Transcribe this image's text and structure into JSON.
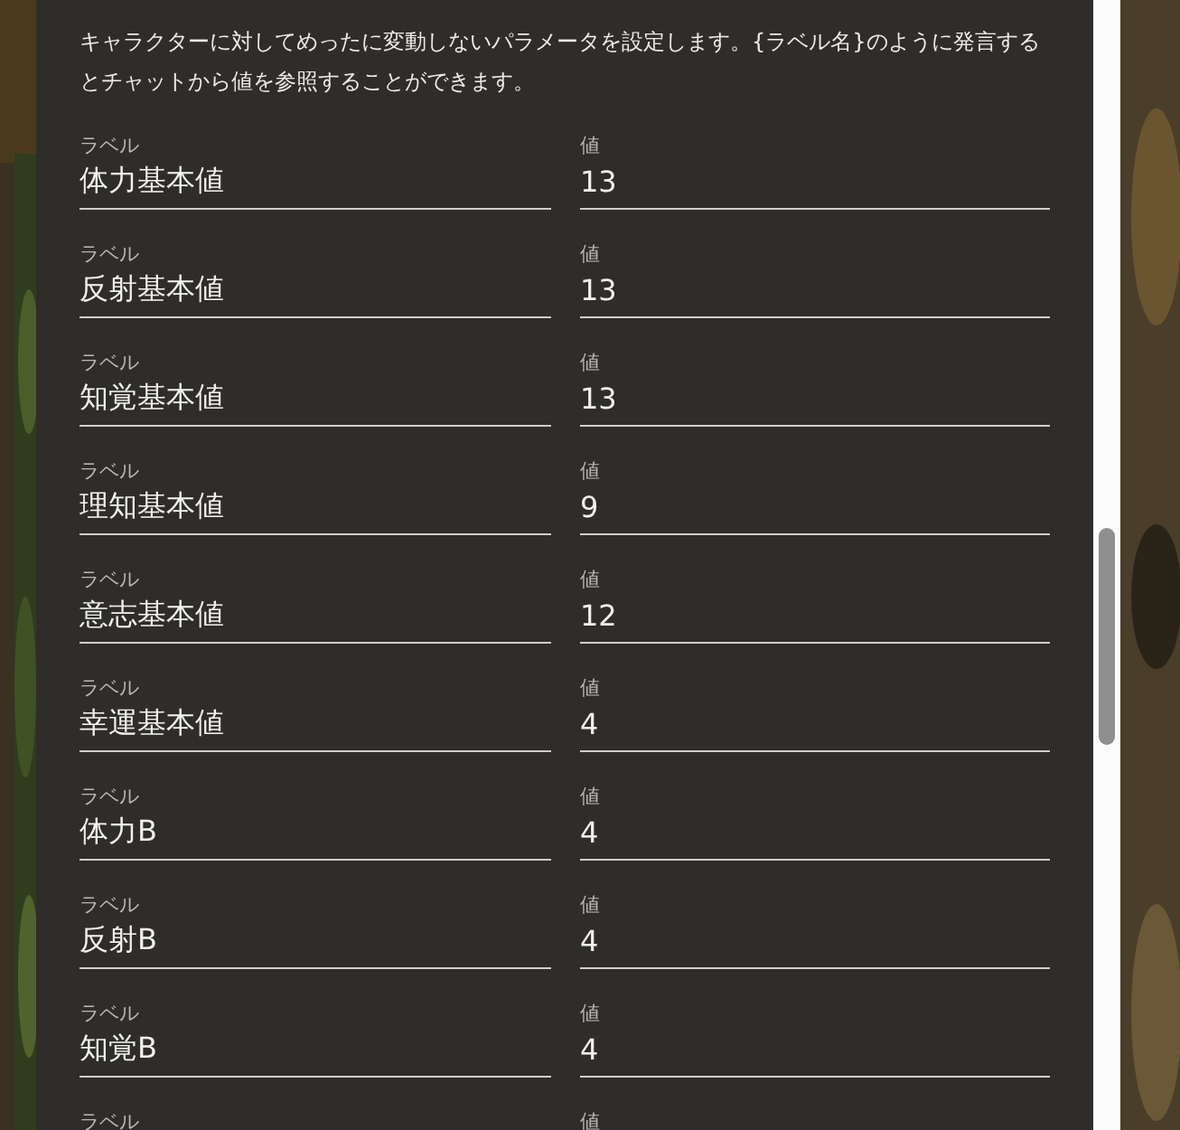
{
  "description": "キャラクターに対してめったに変動しないパラメータを設定します。{ラベル名}のように発言するとチャットから値を参照することができます。",
  "params": [
    {
      "label_caption": "ラベル",
      "label": "体力基本値",
      "value_caption": "値",
      "value": "13"
    },
    {
      "label_caption": "ラベル",
      "label": "反射基本値",
      "value_caption": "値",
      "value": "13"
    },
    {
      "label_caption": "ラベル",
      "label": "知覚基本値",
      "value_caption": "値",
      "value": "13"
    },
    {
      "label_caption": "ラベル",
      "label": "理知基本値",
      "value_caption": "値",
      "value": "9"
    },
    {
      "label_caption": "ラベル",
      "label": "意志基本値",
      "value_caption": "値",
      "value": "12"
    },
    {
      "label_caption": "ラベル",
      "label": "幸運基本値",
      "value_caption": "値",
      "value": "4"
    },
    {
      "label_caption": "ラベル",
      "label": "体力B",
      "value_caption": "値",
      "value": "4"
    },
    {
      "label_caption": "ラベル",
      "label": "反射B",
      "value_caption": "値",
      "value": "4"
    },
    {
      "label_caption": "ラベル",
      "label": "知覚B",
      "value_caption": "値",
      "value": "4"
    },
    {
      "label_caption": "ラベル",
      "value_caption": "値"
    }
  ]
}
